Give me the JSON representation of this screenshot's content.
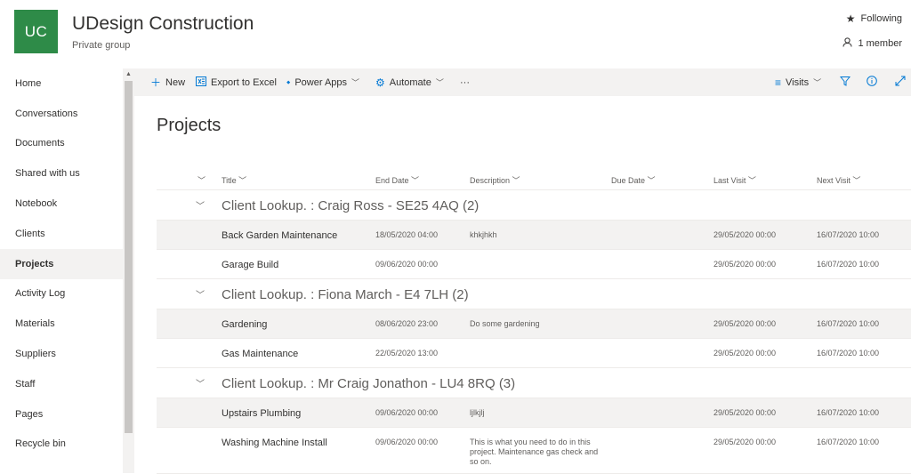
{
  "site": {
    "logo_text": "UC",
    "title": "UDesign Construction",
    "subtitle": "Private group",
    "following_label": "Following",
    "members_label": "1 member",
    "brand_color": "#2e8b48"
  },
  "nav": {
    "items": [
      {
        "label": "Home"
      },
      {
        "label": "Conversations"
      },
      {
        "label": "Documents"
      },
      {
        "label": "Shared with us"
      },
      {
        "label": "Notebook"
      },
      {
        "label": "Clients"
      },
      {
        "label": "Projects",
        "active": true
      },
      {
        "label": "Activity Log"
      },
      {
        "label": "Materials"
      },
      {
        "label": "Suppliers"
      },
      {
        "label": "Staff"
      },
      {
        "label": "Pages"
      },
      {
        "label": "Recycle bin"
      }
    ]
  },
  "commandbar": {
    "new_label": "New",
    "export_label": "Export to Excel",
    "powerapps_label": "Power Apps",
    "automate_label": "Automate",
    "more_label": "···",
    "view_label": "Visits",
    "accent_color": "#0078d4"
  },
  "list": {
    "title": "Projects",
    "columns": {
      "title": "Title",
      "end_date": "End Date",
      "description": "Description",
      "due_date": "Due Date",
      "last_visit": "Last Visit",
      "next_visit": "Next Visit"
    },
    "groups": [
      {
        "label": "Client Lookup. : Craig Ross - SE25 4AQ (2)",
        "rows": [
          {
            "title": "Back Garden Maintenance",
            "end_date": "18/05/2020 04:00",
            "description": "khkjhkh",
            "due_date": "",
            "last_visit": "29/05/2020 00:00",
            "next_visit": "16/07/2020 10:00"
          },
          {
            "title": "Garage Build",
            "end_date": "09/06/2020 00:00",
            "description": "",
            "due_date": "",
            "last_visit": "29/05/2020 00:00",
            "next_visit": "16/07/2020 10:00"
          }
        ]
      },
      {
        "label": "Client Lookup. : Fiona March - E4 7LH (2)",
        "rows": [
          {
            "title": "Gardening",
            "end_date": "08/06/2020 23:00",
            "description": "Do some gardening",
            "due_date": "",
            "last_visit": "29/05/2020 00:00",
            "next_visit": "16/07/2020 10:00"
          },
          {
            "title": "Gas Maintenance",
            "end_date": "22/05/2020 13:00",
            "description": "",
            "due_date": "",
            "last_visit": "29/05/2020 00:00",
            "next_visit": "16/07/2020 10:00"
          }
        ]
      },
      {
        "label": "Client Lookup. : Mr Craig Jonathon - LU4 8RQ (3)",
        "rows": [
          {
            "title": "Upstairs Plumbing",
            "end_date": "09/06/2020 00:00",
            "description": "ljlkjlj",
            "due_date": "",
            "last_visit": "29/05/2020 00:00",
            "next_visit": "16/07/2020 10:00"
          },
          {
            "title": "Washing Machine Install",
            "end_date": "09/06/2020 00:00",
            "description": "This is what you need to do in this project. Maintenance gas check and so on.",
            "due_date": "",
            "last_visit": "29/05/2020 00:00",
            "next_visit": "16/07/2020 10:00"
          }
        ]
      }
    ]
  }
}
